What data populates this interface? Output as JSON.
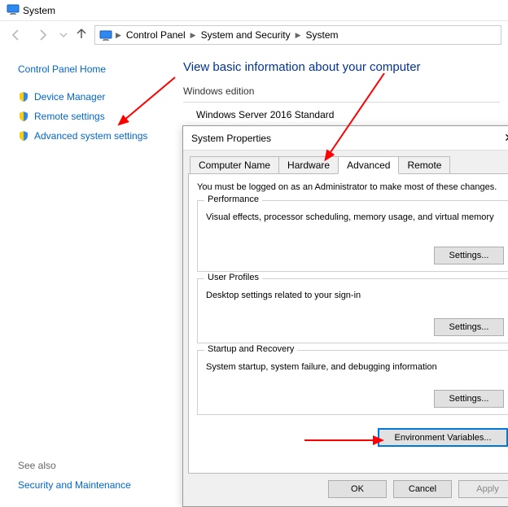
{
  "window": {
    "title": "System"
  },
  "breadcrumbs": [
    "Control Panel",
    "System and Security",
    "System"
  ],
  "sidebar": {
    "home": "Control Panel Home",
    "items": [
      {
        "icon": "shield",
        "label": "Device Manager"
      },
      {
        "icon": "shield",
        "label": "Remote settings"
      },
      {
        "icon": "shield",
        "label": "Advanced system settings"
      }
    ]
  },
  "main": {
    "heading": "View basic information about your computer",
    "editionTitle": "Windows edition",
    "editionValue": "Windows Server 2016 Standard"
  },
  "seealso": {
    "title": "See also",
    "links": [
      "Security and Maintenance"
    ]
  },
  "dialog": {
    "title": "System Properties",
    "tabs": [
      "Computer Name",
      "Hardware",
      "Advanced",
      "Remote"
    ],
    "activeTab": 2,
    "intro": "You must be logged on as an Administrator to make most of these changes.",
    "groups": {
      "performance": {
        "title": "Performance",
        "text": "Visual effects, processor scheduling, memory usage, and virtual memory",
        "button": "Settings..."
      },
      "userProfiles": {
        "title": "User Profiles",
        "text": "Desktop settings related to your sign-in",
        "button": "Settings..."
      },
      "startup": {
        "title": "Startup and Recovery",
        "text": "System startup, system failure, and debugging information",
        "button": "Settings..."
      }
    },
    "envButton": "Environment Variables...",
    "buttons": {
      "ok": "OK",
      "cancel": "Cancel",
      "apply": "Apply"
    }
  }
}
